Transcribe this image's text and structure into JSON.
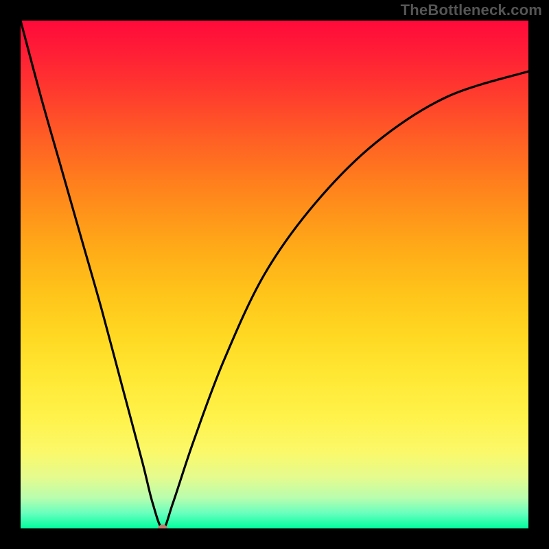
{
  "watermark": "TheBottleneck.com",
  "colors": {
    "frame_bg": "#000000",
    "curve": "#000000",
    "marker": "#c77b6e",
    "gradient_top": "#ff0a3a",
    "gradient_bottom": "#00ff9e",
    "watermark": "#555555"
  },
  "chart_data": {
    "type": "line",
    "title": "",
    "xlabel": "",
    "ylabel": "",
    "xlim": [
      0,
      100
    ],
    "ylim": [
      0,
      100
    ],
    "grid": false,
    "legend": false,
    "note": "Gradient background encodes bottleneck severity: red=100% (top), green=0% (bottom). Single black V-shaped curve with minimum near x≈28.",
    "series": [
      {
        "name": "bottleneck-curve",
        "x": [
          0,
          4,
          8,
          12,
          16,
          20,
          24,
          26,
          28,
          30,
          34,
          40,
          48,
          58,
          70,
          84,
          100
        ],
        "y": [
          100,
          85,
          71,
          57,
          43,
          28,
          13,
          5,
          0,
          5,
          17,
          33,
          50,
          64,
          76,
          85,
          90
        ]
      }
    ],
    "marker": {
      "x": 28,
      "y": 0
    }
  }
}
